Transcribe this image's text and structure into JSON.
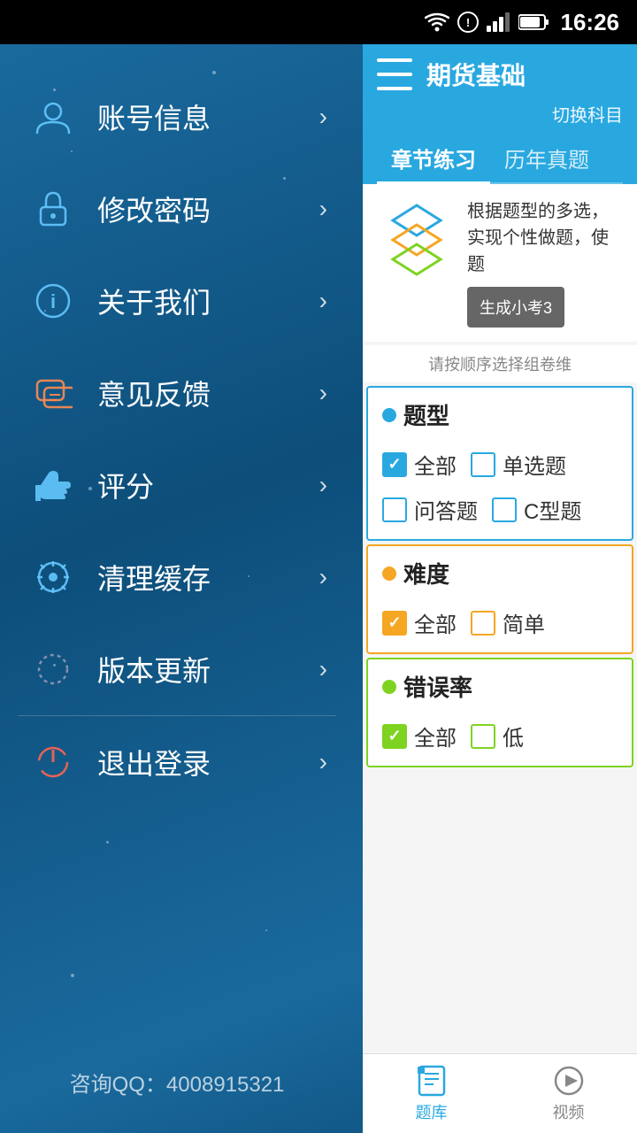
{
  "statusBar": {
    "time": "16:26"
  },
  "sidebar": {
    "items": [
      {
        "id": "account",
        "label": "账号信息",
        "icon": "👤"
      },
      {
        "id": "password",
        "label": "修改密码",
        "icon": "🔒"
      },
      {
        "id": "about",
        "label": "关于我们",
        "icon": "ℹ️"
      },
      {
        "id": "feedback",
        "label": "意见反馈",
        "icon": "💬"
      },
      {
        "id": "rate",
        "label": "评分",
        "icon": "👍"
      },
      {
        "id": "cache",
        "label": "清理缓存",
        "icon": "⚙️"
      },
      {
        "id": "update",
        "label": "版本更新",
        "icon": "🔄"
      },
      {
        "id": "logout",
        "label": "退出登录",
        "icon": "⏻"
      }
    ],
    "footer": "咨询QQ：4008915321"
  },
  "panel": {
    "title": "期货基础",
    "subtitle": "切换科目",
    "tabs": [
      {
        "id": "chapter",
        "label": "章节练习",
        "active": true
      },
      {
        "id": "past",
        "label": "历年真题",
        "active": false
      }
    ],
    "banner": {
      "text": "根据题型的多选，实现个性做题，使题",
      "buttonLabel": "生成小考3"
    },
    "hintText": "请按顺序选择组卷维",
    "sections": [
      {
        "id": "question-type",
        "title": "题型",
        "dotColor": "blue",
        "checkboxes": [
          {
            "label": "全部",
            "checked": true
          },
          {
            "label": "单选题",
            "checked": false
          },
          {
            "label": "问答题",
            "checked": false
          },
          {
            "label": "C型题",
            "checked": false
          }
        ]
      },
      {
        "id": "difficulty",
        "title": "难度",
        "dotColor": "orange",
        "checkboxes": [
          {
            "label": "全部",
            "checked": true
          },
          {
            "label": "简单",
            "checked": false
          }
        ]
      },
      {
        "id": "error-rate",
        "title": "错误率",
        "dotColor": "green",
        "checkboxes": [
          {
            "label": "全部",
            "checked": true
          },
          {
            "label": "低",
            "checked": false
          }
        ]
      }
    ],
    "bottomNav": [
      {
        "id": "questions",
        "label": "题库",
        "icon": "📋",
        "active": true
      },
      {
        "id": "video",
        "label": "视频",
        "icon": "▶",
        "active": false
      }
    ]
  }
}
